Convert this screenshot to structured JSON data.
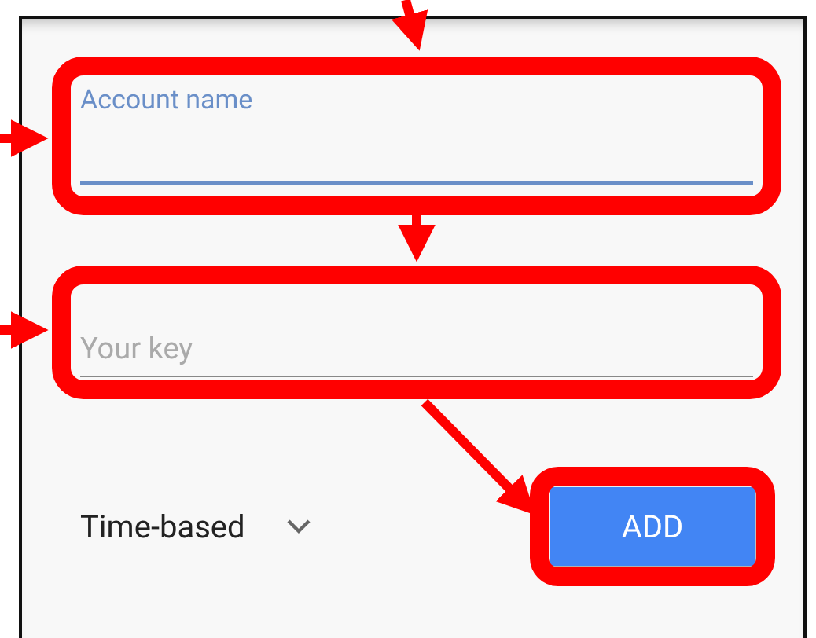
{
  "fields": [
    {
      "kind": "floating",
      "label": "Account name",
      "focused": true
    },
    {
      "kind": "hint",
      "placeholder": "Your key",
      "focused": false
    }
  ],
  "type_select": {
    "value": "Time-based"
  },
  "add_button": {
    "label": "ADD"
  }
}
